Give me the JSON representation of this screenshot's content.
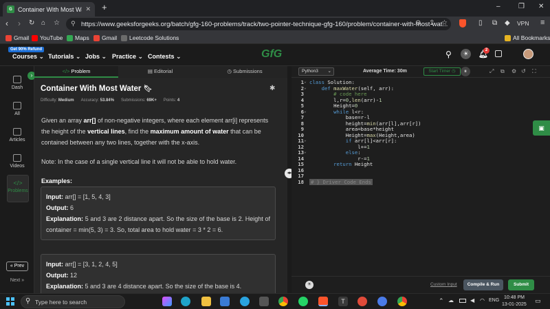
{
  "browser": {
    "tab_title": "Container With Most Water | Pr",
    "url": "https://www.geeksforgeeks.org/batch/gfg-160-problems/track/two-pointer-technique-gfg-160/problem/container-with-most-wat...",
    "vpn_label": "VPN",
    "bookmarks": [
      "Gmail",
      "YouTube",
      "Maps",
      "Gmail",
      "Leetcode Solutions"
    ],
    "all_bookmarks": "All Bookmarks"
  },
  "gfg_nav": {
    "refund_badge": "Get 90% Refund",
    "courses": "Courses",
    "tutorials": "Tutorials",
    "jobs": "Jobs",
    "practice": "Practice",
    "contests": "Contests",
    "logo": "GfG",
    "notif_count": "2"
  },
  "sidebar": {
    "items": [
      "Dash",
      "All",
      "Articles",
      "Videos",
      "Problems"
    ],
    "prev": "Prev",
    "next": "Next"
  },
  "problem_tabs": [
    "Problem",
    "Editorial",
    "Submissions"
  ],
  "problem": {
    "title": "Container With Most Water",
    "difficulty_label": "Difficulty:",
    "difficulty": "Medium",
    "accuracy_label": "Accuracy:",
    "accuracy": "53.84%",
    "submissions_label": "Submissions:",
    "submissions": "69K+",
    "points_label": "Points:",
    "points": "4",
    "desc_p1_a": "Given an array ",
    "desc_p1_b": "arr[]",
    "desc_p1_c": " of non-negative integers, where each element arr[i] represents the height of the ",
    "desc_p1_d": "vertical lines",
    "desc_p1_e": ", find the ",
    "desc_p1_f": "maximum amount of water",
    "desc_p1_g": " that can be contained between any two lines, together with the x-axis.",
    "note": "Note: In the case of a single vertical line it will not be able to hold water.",
    "examples_label": "Examples:",
    "input_label": "Input:",
    "output_label": "Output:",
    "explanation_label": "Explanation:",
    "ex1_input": "arr[] = [1, 5, 4, 3]",
    "ex1_output": "6",
    "ex1_explanation": "5 and 3 are 2 distance apart. So the size of the base is 2. Height of container = min(5, 3) = 3. So, total area to hold water = 3 * 2 = 6.",
    "ex2_input": "arr[] = [3, 1, 2, 4, 5]",
    "ex2_output": "12",
    "ex2_explanation": "5 and 3 are 4 distance apart. So the size of the base is 4."
  },
  "editor": {
    "language": "Python3",
    "average_time": "Average Time: 30m",
    "start_timer": "Start Timer",
    "lines": [
      "class Solution:",
      "    def maxWater(self, arr):",
      "        # code here",
      "        l,r=0,len(arr)-1",
      "        Height=0",
      "        while l<r:",
      "            base=r-l",
      "            height=min(arr[l],arr[r])",
      "            area=base*height",
      "            Height=max(Height,area)",
      "            if arr[l]<arr[r]:",
      "                l+=1",
      "            else:",
      "                r-=1",
      "        return Height",
      "",
      "",
      "# } Driver Code Ends"
    ],
    "custom_input": "Custom Input",
    "compile_run": "Compile & Run",
    "submit": "Submit"
  },
  "taskbar": {
    "search_placeholder": "Type here to search",
    "lang": "ENG",
    "time": "10:48 PM",
    "date": "13-01-2025"
  }
}
